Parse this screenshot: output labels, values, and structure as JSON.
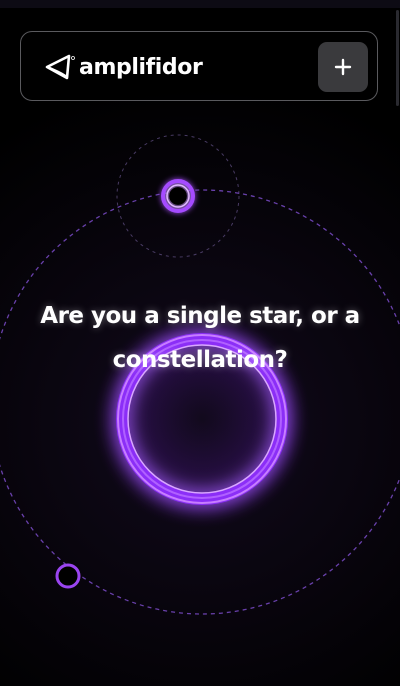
{
  "header": {
    "logo_text": "amplifidor",
    "add_label": "+"
  },
  "hero": {
    "headline": "Are you a single star, or a constellation?"
  },
  "colors": {
    "background": "#000000",
    "accent": "#a54bff",
    "accent_glow": "#8e2cff",
    "dashed_ring": "#7a4bc8",
    "header_border": "#5a5a5e",
    "button_bg": "#3a3a3d"
  },
  "icons": {
    "logo": "triangle-wave-logo-icon",
    "add": "plus-icon"
  }
}
